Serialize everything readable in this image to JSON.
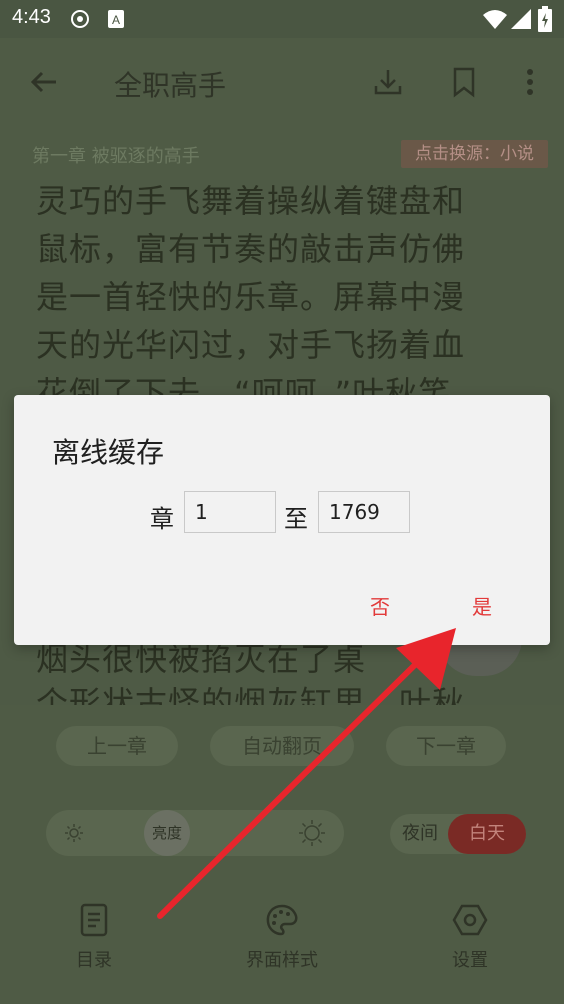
{
  "status_bar": {
    "time": "4:43",
    "icons": [
      "sync-icon",
      "a-badge-icon",
      "wifi-icon",
      "signal-icon",
      "battery-icon"
    ]
  },
  "app_bar": {
    "title": "全职高手",
    "icons": [
      "back-arrow-icon",
      "download-icon",
      "bookmark-icon",
      "more-vert-icon"
    ]
  },
  "chapter": {
    "title": "第一章 被驱逐的高手",
    "source_badge": "点击换源：小说"
  },
  "content": {
    "lines": [
      "灵巧的手飞舞着操纵着键盘和",
      "鼠标，富有节奏的敲击声仿佛",
      "是一首轻快的乐章。屏幕中漫",
      "天的光华闪过，对手飞扬着血",
      "花倒了下去。“呵呵。”叶秋笑",
      "烟头很快被掐灭在了桌",
      "个形状古怪的烟灰缸里。叶秋"
    ]
  },
  "dialog": {
    "title": "离线缓存",
    "chapter_label": "章",
    "from_value": "1",
    "to_label": "至",
    "to_value": "1769",
    "no_label": "否",
    "yes_label": "是"
  },
  "bottom_menu": {
    "prev_chapter": "上一章",
    "auto_page": "自动翻页",
    "next_chapter": "下一章",
    "brightness": "亮度",
    "night": "夜间",
    "day": "白天",
    "toc": "目录",
    "style": "界面样式",
    "settings": "设置"
  },
  "colors": {
    "accent_red": "#e23a3a",
    "background": "#4f5b45",
    "dialog_bg": "#f2f2f2"
  }
}
